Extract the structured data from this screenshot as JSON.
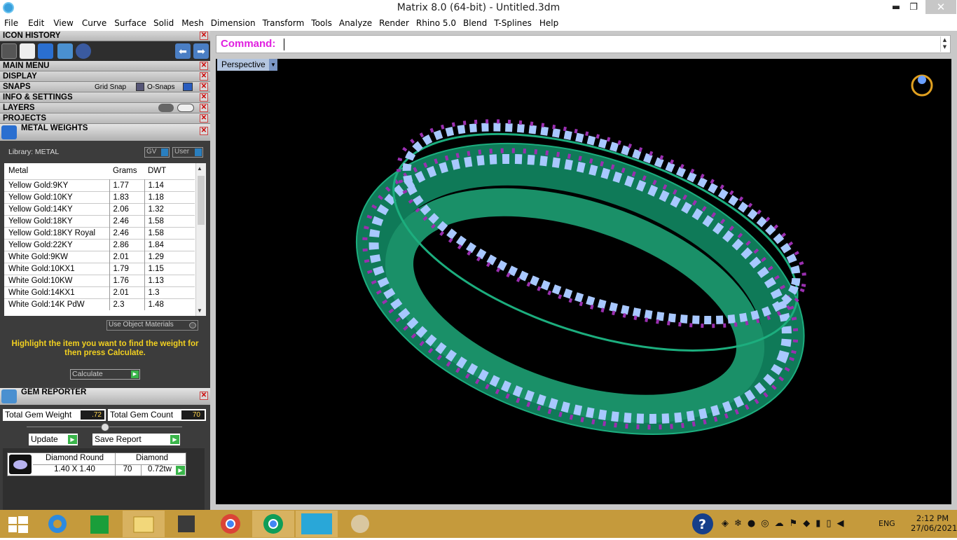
{
  "window": {
    "title": "Matrix 8.0 (64-bit) - Untitled.3dm",
    "minimize": "▬",
    "restore": "❐",
    "close": "✕"
  },
  "menu": [
    "File",
    "Edit",
    "View",
    "Curve",
    "Surface",
    "Solid",
    "Mesh",
    "Dimension",
    "Transform",
    "Tools",
    "Analyze",
    "Render",
    "Rhino 5.0",
    "Blend",
    "T-Splines",
    "Help"
  ],
  "panel": {
    "icon_history": "ICON HISTORY",
    "main_menu": "MAIN MENU",
    "display": "DISPLAY",
    "snaps": "SNAPS",
    "grid_snap": "Grid Snap",
    "o_snaps": "O-Snaps",
    "info_settings": "INFO & SETTINGS",
    "layers": "LAYERS",
    "projects": "PROJECTS",
    "close_glyph": "✕"
  },
  "metal_weights": {
    "title": "METAL WEIGHTS",
    "library": "Library: METAL",
    "gv": "GV",
    "user": "User",
    "columns": [
      "Metal",
      "Grams",
      "DWT"
    ],
    "rows": [
      [
        "Yellow Gold:9KY",
        "1.77",
        "1.14"
      ],
      [
        "Yellow Gold:10KY",
        "1.83",
        "1.18"
      ],
      [
        "Yellow Gold:14KY",
        "2.06",
        "1.32"
      ],
      [
        "Yellow Gold:18KY",
        "2.46",
        "1.58"
      ],
      [
        "Yellow Gold:18KY Royal",
        "2.46",
        "1.58"
      ],
      [
        "Yellow Gold:22KY",
        "2.86",
        "1.84"
      ],
      [
        "White Gold:9KW",
        "2.01",
        "1.29"
      ],
      [
        "White Gold:10KX1",
        "1.79",
        "1.15"
      ],
      [
        "White Gold:10KW",
        "1.76",
        "1.13"
      ],
      [
        "White Gold:14KX1",
        "2.01",
        "1.3"
      ],
      [
        "White Gold:14K PdW",
        "2.3",
        "1.48"
      ]
    ],
    "use_object_materials": "Use Object Materials",
    "hint": "Highlight the item you want to find the weight for then press Calculate.",
    "calculate": "Calculate"
  },
  "gem_reporter": {
    "title": "GEM REPORTER",
    "total_weight_label": "Total Gem Weight",
    "total_weight": ".72",
    "total_count_label": "Total Gem Count",
    "total_count": "70",
    "update": "Update",
    "save_report": "Save Report",
    "gem": {
      "shape": "Diamond Round",
      "material": "Diamond",
      "size": "1.40 X 1.40",
      "count": "70",
      "weight": "0.72tw"
    }
  },
  "command": {
    "label": "Command:",
    "value": ""
  },
  "viewport": {
    "name": "Perspective"
  },
  "tray": {
    "lang": "ENG",
    "time": "2:12 PM",
    "date": "27/06/2021"
  },
  "colors": {
    "metal": "#1a8f6a",
    "gem": "#a8c8ff",
    "accent_gem": "#9a2fb0",
    "taskbar": "#c59a3c"
  }
}
